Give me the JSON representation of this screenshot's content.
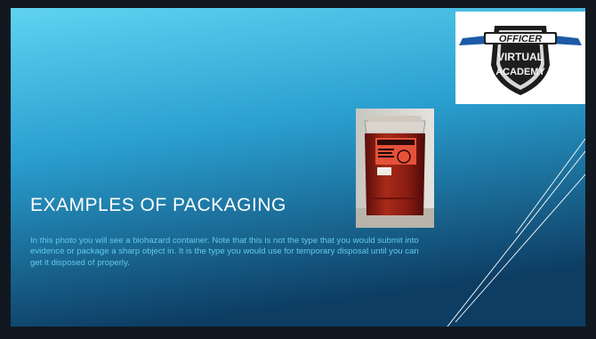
{
  "slide": {
    "title": "EXAMPLES OF PACKAGING",
    "body": "In this photo you will see a biohazard container. Note that this is not the type that you would submit into evidence or package a sharp object in. It is the type you would use for temporary disposal until you can get it disposed of properly.",
    "colors": {
      "background_top": "#5fd3f0",
      "background_bottom": "#0d3d63",
      "frame": "#111820",
      "body_text": "#63c9ea",
      "title_text": "#ffffff"
    }
  },
  "logo": {
    "line1": "OFFICER",
    "line2": "VIRTUAL",
    "line3": "ACADEMY",
    "icon": "shield-icon"
  },
  "photo": {
    "subject": "biohazard-sharps-container"
  }
}
